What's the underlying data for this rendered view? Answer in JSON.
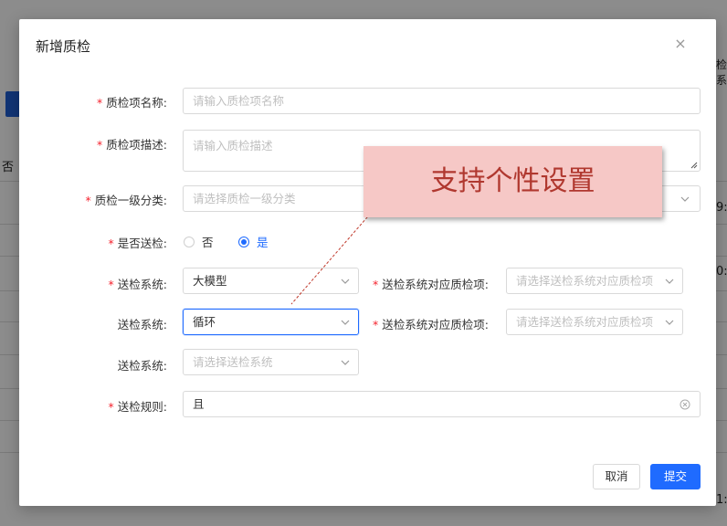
{
  "background": {
    "fragments": [
      "否",
      "9:",
      "0:",
      "1:",
      "检系"
    ]
  },
  "modal": {
    "title": "新增质检",
    "close_glyph": "×"
  },
  "form": {
    "name": {
      "label": "质检项名称:",
      "required": true,
      "placeholder": "请输入质检项名称"
    },
    "desc": {
      "label": "质检项描述:",
      "required": true,
      "placeholder": "请输入质检描述"
    },
    "category": {
      "label": "质检一级分类:",
      "required": true,
      "placeholder": "请选择质检一级分类"
    },
    "send_check": {
      "label": "是否送检:",
      "required": true,
      "options": [
        {
          "label": "否",
          "selected": false
        },
        {
          "label": "是",
          "selected": true
        }
      ]
    },
    "system_rows": [
      {
        "label": "送检系统:",
        "required": true,
        "value": "大模型",
        "placeholder": "",
        "item_label": "送检系统对应质检项:",
        "item_required": true,
        "item_placeholder": "请选择送检系统对应质检项"
      },
      {
        "label": "送检系统:",
        "required": false,
        "value": "循环",
        "placeholder": "",
        "item_label": "送检系统对应质检项:",
        "item_required": true,
        "item_placeholder": "请选择送检系统对应质检项"
      },
      {
        "label": "送检系统:",
        "required": false,
        "value": "",
        "placeholder": "请选择送检系统"
      }
    ],
    "rule": {
      "label": "送检规则:",
      "required": true,
      "value": "且"
    }
  },
  "footer": {
    "cancel_label": "取消",
    "submit_label": "提交"
  },
  "annotation": {
    "text": "支持个性设置"
  },
  "colors": {
    "primary": "#1f6bff",
    "required": "#f5222d",
    "callout_bg": "#f6c8c6",
    "callout_text": "#b0382f"
  }
}
